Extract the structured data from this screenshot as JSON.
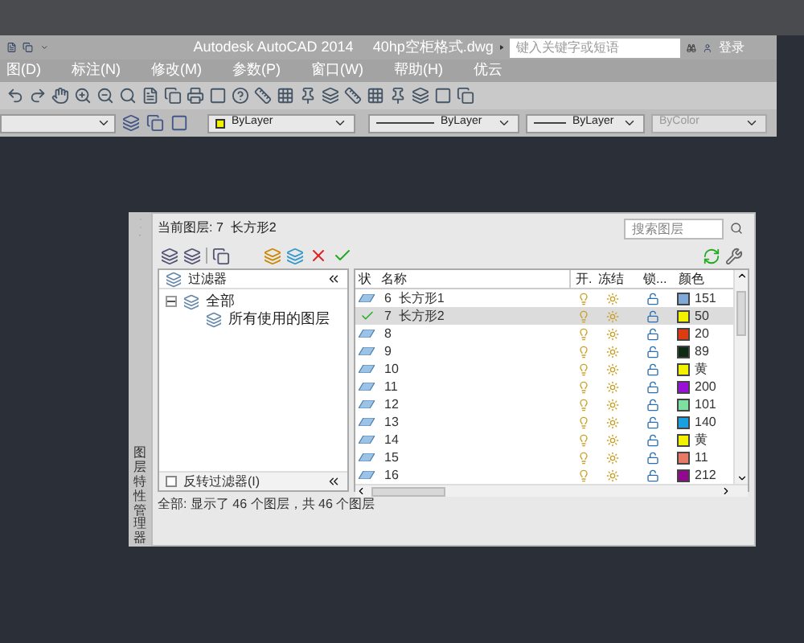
{
  "app": {
    "title": "Autodesk AutoCAD 2014",
    "file": "40hp空柜格式.dwg",
    "search_placeholder": "键入关键字或短语",
    "login": "登录"
  },
  "menu": [
    "图(D)",
    "标注(N)",
    "修改(M)",
    "参数(P)",
    "窗口(W)",
    "帮助(H)",
    "优云"
  ],
  "properties_bar": {
    "color_label": "ByLayer",
    "linetype": "ByLayer",
    "lineweight": "ByLayer",
    "plotstyle": "ByColor"
  },
  "palette": {
    "side_title": "图层特性管理器",
    "current_layer": "当前图层: 7  长方形2",
    "search_placeholder": "搜索图层",
    "filters": {
      "header": "过滤器",
      "tree": [
        {
          "label": "全部",
          "expanded": true,
          "children": [
            {
              "label": "所有使用的图层"
            }
          ]
        }
      ],
      "invert_label": "反转过滤器(I)",
      "invert_checked": false
    },
    "columns": [
      "状",
      "名称",
      "开.",
      "冻结",
      "锁...",
      "颜色"
    ],
    "layers": [
      {
        "name": "6  长方形1",
        "current": false,
        "selected": false,
        "color": "#7fa9d9",
        "color_name": "151"
      },
      {
        "name": "7  长方形2",
        "current": true,
        "selected": true,
        "color": "#f2f200",
        "color_name": "50"
      },
      {
        "name": "8",
        "current": false,
        "selected": false,
        "color": "#e03a10",
        "color_name": "20"
      },
      {
        "name": "9",
        "current": false,
        "selected": false,
        "color": "#0f2a14",
        "color_name": "89"
      },
      {
        "name": "10",
        "current": false,
        "selected": false,
        "color": "#f2f200",
        "color_name": "黄"
      },
      {
        "name": "11",
        "current": false,
        "selected": false,
        "color": "#9a10d8",
        "color_name": "200"
      },
      {
        "name": "12",
        "current": false,
        "selected": false,
        "color": "#7ee0a0",
        "color_name": "101"
      },
      {
        "name": "13",
        "current": false,
        "selected": false,
        "color": "#1aa0e0",
        "color_name": "140"
      },
      {
        "name": "14",
        "current": false,
        "selected": false,
        "color": "#f2f200",
        "color_name": "黄"
      },
      {
        "name": "15",
        "current": false,
        "selected": false,
        "color": "#e87868",
        "color_name": "11"
      },
      {
        "name": "16",
        "current": false,
        "selected": false,
        "color": "#900a90",
        "color_name": "212"
      }
    ],
    "status": "全部: 显示了 46 个图层，共 46 个图层"
  }
}
